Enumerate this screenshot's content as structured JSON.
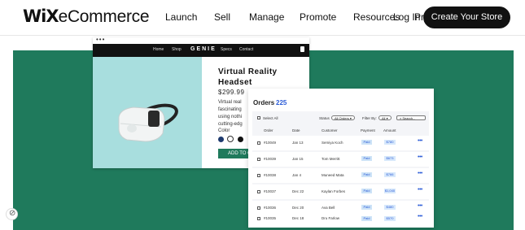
{
  "header": {
    "logo_brand": "WiX",
    "logo_product": "eCommerce",
    "nav": [
      "Launch",
      "Sell",
      "Manage",
      "Promote",
      "Resources",
      "Log In",
      "Pri"
    ],
    "cta_label": "Create Your Store"
  },
  "store": {
    "nav_links": [
      "Home",
      "Shop",
      "Specs",
      "Contact"
    ],
    "brand": "GENIE",
    "product_title": "Virtual Reality Headset",
    "price": "$299.99",
    "description_lines": [
      "Virtual real",
      "fascinating",
      "using nothi",
      "cutting-edg"
    ],
    "color_label": "Color",
    "swatch_colors": [
      "#1e3a6e",
      "#ffffff",
      "#111111"
    ],
    "add_to_cart": "ADD TO CART"
  },
  "orders": {
    "title": "Orders",
    "count": "225",
    "select_all": "Select All",
    "status_label": "Status",
    "status_value": "All Orders",
    "filter_label": "Filter By:",
    "filter_value": "All",
    "search_placeholder": "Search...",
    "columns": [
      "Order",
      "Date",
      "Customer",
      "Payment",
      "Amount"
    ],
    "rows": [
      {
        "order": "#10049",
        "date": "Jan 13",
        "customer": "Semiya Koch",
        "payment": "Paid",
        "amount": "$780"
      },
      {
        "order": "#10039",
        "date": "Jan 15",
        "customer": "Tom Merritt",
        "payment": "Paid",
        "amount": "$673"
      },
      {
        "order": "#10038",
        "date": "Jan 4",
        "customer": "Muneed Mata",
        "payment": "Paid",
        "amount": "$766"
      },
      {
        "order": "#10037",
        "date": "Dec 22",
        "customer": "Kaylan Forbes",
        "payment": "Paid",
        "amount": "$1,040"
      },
      {
        "order": "#10036",
        "date": "Dec 20",
        "customer": "Ava Bell",
        "payment": "Paid",
        "amount": "$480"
      },
      {
        "order": "#10035",
        "date": "Dec 18",
        "customer": "Dru Farlow",
        "payment": "Paid",
        "amount": "$570"
      }
    ]
  },
  "colors": {
    "hero_green": "#1f7a5c",
    "cta_black": "#111111",
    "accent_blue": "#2a5bd7"
  }
}
